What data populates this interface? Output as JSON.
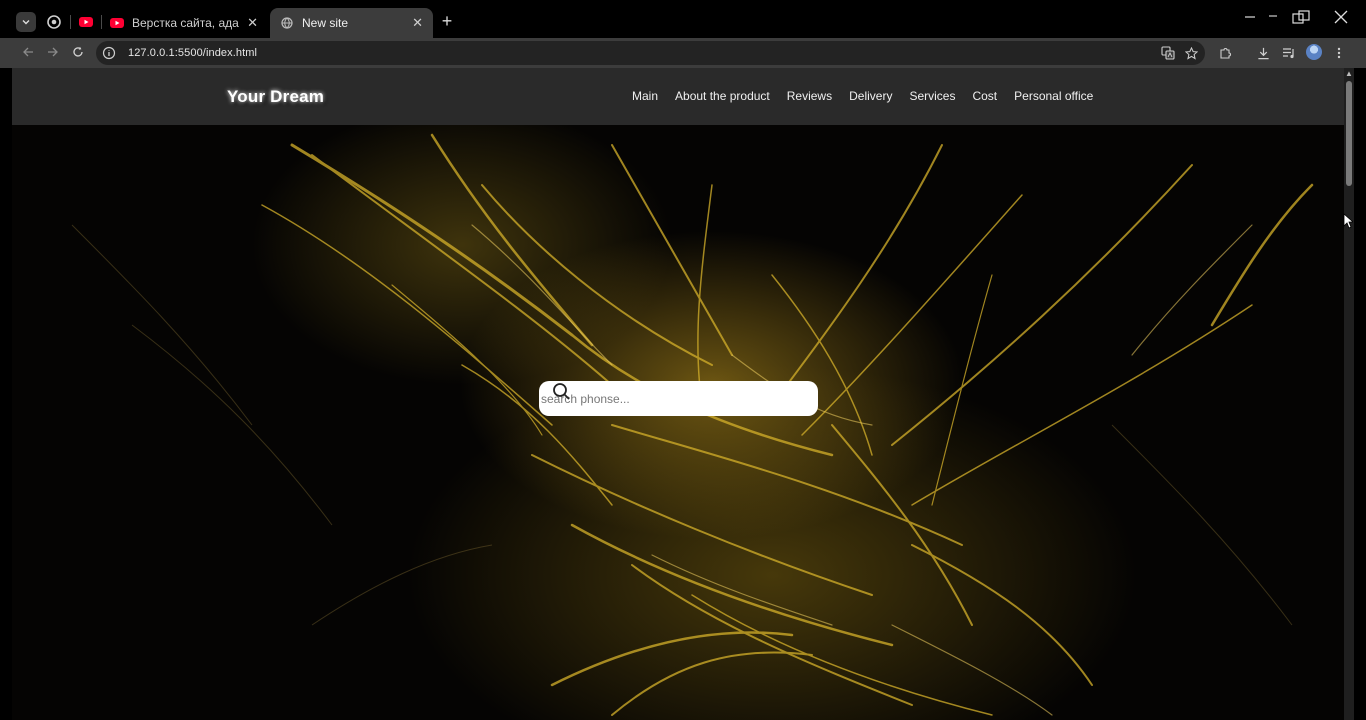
{
  "browser": {
    "tabs": [
      {
        "title": "Верстка сайта, адаптив сайта, ",
        "favicon": "youtube-icon",
        "active": false
      },
      {
        "title": "New site",
        "favicon": "globe-icon",
        "active": true
      }
    ],
    "pinned": [
      "chrome-icon",
      "youtube-icon"
    ],
    "url": "127.0.0.1:5500/index.html",
    "accent": "#3c3c3c"
  },
  "site": {
    "logo": "Your Dream",
    "nav": [
      "Main",
      "About the product",
      "Reviews",
      "Delivery",
      "Services",
      "Cost",
      "Personal office"
    ],
    "search": {
      "placeholder": "search phonse..."
    },
    "colors": {
      "header_bg": "#2a2a2a",
      "hero_gold": "#c9a227"
    }
  }
}
